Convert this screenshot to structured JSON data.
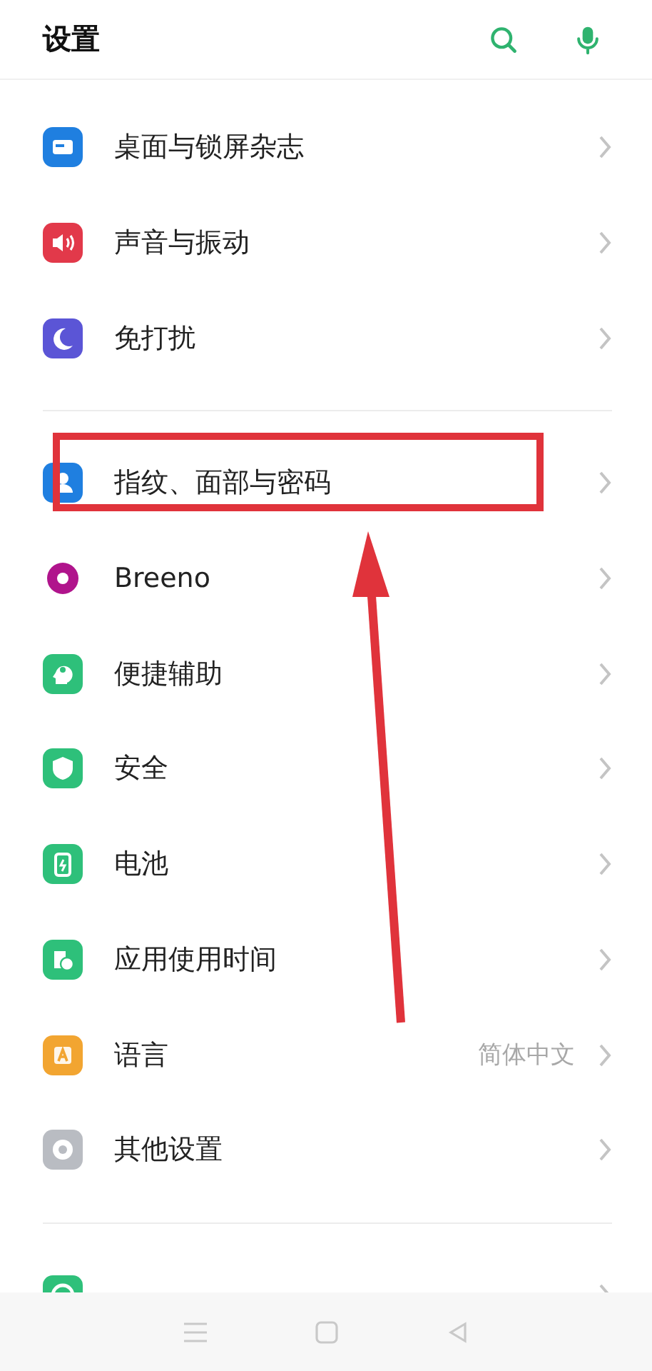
{
  "header": {
    "title": "设置"
  },
  "sections": [
    {
      "items": [
        {
          "label": "桌面与锁屏杂志",
          "color": "#1f7fe0"
        },
        {
          "label": "声音与振动",
          "color": "#e2394a"
        },
        {
          "label": "免打扰",
          "color": "#5b55d6"
        }
      ]
    },
    {
      "items": [
        {
          "label": "指纹、面部与密码",
          "color": "#1f7fe0"
        },
        {
          "label": "Breeno",
          "color": "#b0148c"
        },
        {
          "label": "便捷辅助",
          "color": "#2ec07a"
        },
        {
          "label": "安全",
          "color": "#2ec07a"
        },
        {
          "label": "电池",
          "color": "#2ec07a"
        },
        {
          "label": "应用使用时间",
          "color": "#2ec07a"
        },
        {
          "label": "语言",
          "value": "简体中文",
          "color": "#f2a531"
        },
        {
          "label": "其他设置",
          "color": "#b9bcc2"
        }
      ]
    },
    {
      "items": [
        {
          "color": "#2ec07a"
        }
      ]
    }
  ]
}
